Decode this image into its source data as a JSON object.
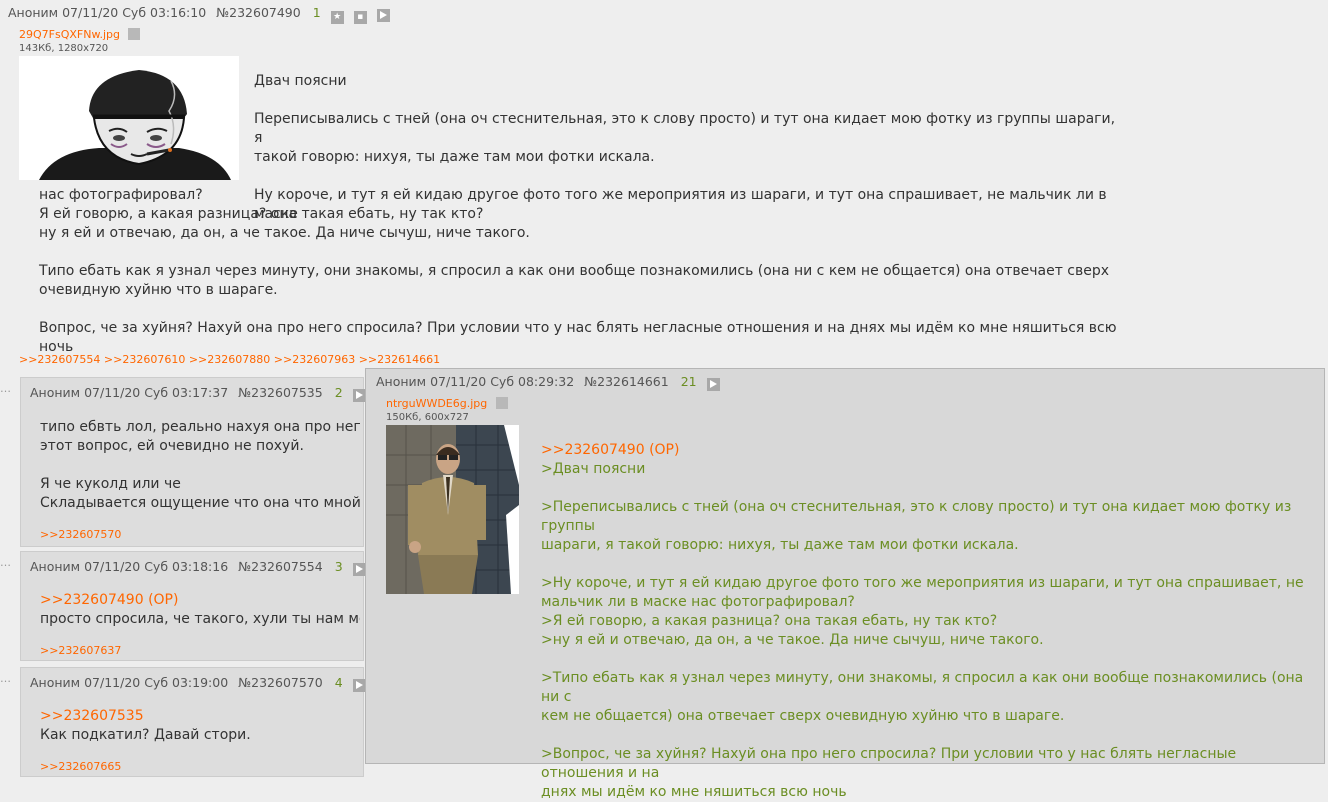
{
  "op": {
    "author": "Аноним",
    "datetime": "07/11/20 Суб 03:16:10",
    "number": "№232607490",
    "index": "1",
    "file": {
      "name": "29Q7FsQXFNw.jpg",
      "meta": "143Кб, 1280x720"
    },
    "lines": [
      "Двач поясни",
      "",
      "Переписывались с тней (она оч стеснительная, это к слову просто) и тут она кидает мою фотку из группы шараги, я",
      "такой говорю: нихуя, ты даже там мои фотки искала.",
      "",
      "Ну короче, и тут я ей кидаю другое фото того же мероприятия из шараги, и тут она спрашивает, не мальчик ли в маске",
      "нас фотографировал?",
      "Я ей говорю, а какая разница? она такая ебать, ну так кто?",
      "ну я ей и отвечаю, да он, а че такое. Да ниче сычуш, ниче такого.",
      "",
      "Типо ебать как я узнал через минуту, они знакомы, я спросил а как они вообще познакомились (она ни с кем не общается) она отвечает сверх",
      "очевидную хуйню что в шараге.",
      "",
      "Вопрос, че за хуйня? Нахуй она про него спросила? При условии что у нас блять негласные отношения и на днях мы идём ко мне няшиться всю ночь"
    ],
    "replies": [
      ">>232607554",
      ">>232607610",
      ">>232607880",
      ">>232607963",
      ">>232614661"
    ]
  },
  "posts": [
    {
      "author": "Аноним",
      "datetime": "07/11/20 Суб 03:17:37",
      "number": "№232607535",
      "index": "2",
      "lines": [
        "типо ебвть лол, реально нахуя она про него сп",
        "этот вопрос, ей очевидно не похуй.",
        "",
        "Я че куколд или че",
        "Складывается ощущение что она что мной тол"
      ],
      "replies": [
        ">>232607570"
      ]
    },
    {
      "author": "Аноним",
      "datetime": "07/11/20 Суб 03:18:16",
      "number": "№232607554",
      "index": "3",
      "reply_to": ">>232607490 (OP)",
      "lines": [
        "просто спросила, че такого, хули ты нам мозги"
      ],
      "replies": [
        ">>232607637"
      ]
    },
    {
      "author": "Аноним",
      "datetime": "07/11/20 Суб 03:19:00",
      "number": "№232607570",
      "index": "4",
      "reply_to": ">>232607535",
      "lines": [
        "Как подкатил? Давай стори."
      ],
      "replies": [
        ">>232607665"
      ]
    }
  ],
  "popup": {
    "author": "Аноним",
    "datetime": "07/11/20 Суб 08:29:32",
    "number": "№232614661",
    "index": "21",
    "file": {
      "name": "ntrguWWDE6g.jpg",
      "meta": "150Кб, 600x727"
    },
    "reply_to": ">>232607490 (OP)",
    "lines": [
      ">Двач поясни",
      "",
      ">Переписывались с тней (она оч стеснительная, это к слову просто) и тут она кидает мою фотку из группы",
      "шараги, я такой говорю: нихуя, ты даже там мои фотки искала.",
      "",
      ">Ну короче, и тут я ей кидаю другое фото того же мероприятия из шараги, и тут она спрашивает, не",
      "мальчик ли в маске нас фотографировал?",
      ">Я ей говорю, а какая разница? она такая ебать, ну так кто?",
      ">ну я ей и отвечаю, да он, а че такое. Да ниче сычуш, ниче такого.",
      "",
      ">Типо ебать как я узнал через минуту, они знакомы, я спросил а как они вообще познакомились (она ни с",
      "кем не общается) она отвечает сверх очевидную хуйню что в шараге.",
      "",
      ">Вопрос, че за хуйня? Нахуй она про него спросила? При условии что у нас блять негласные отношения и на",
      "днях мы идём ко мне няшиться всю ночь"
    ]
  },
  "icons": [
    "star-icon",
    "expand-icon",
    "play-icon",
    "search-icon"
  ],
  "colors": {
    "link": "#ff6600",
    "quote": "#6b8e23",
    "count": "#6b8e23"
  }
}
